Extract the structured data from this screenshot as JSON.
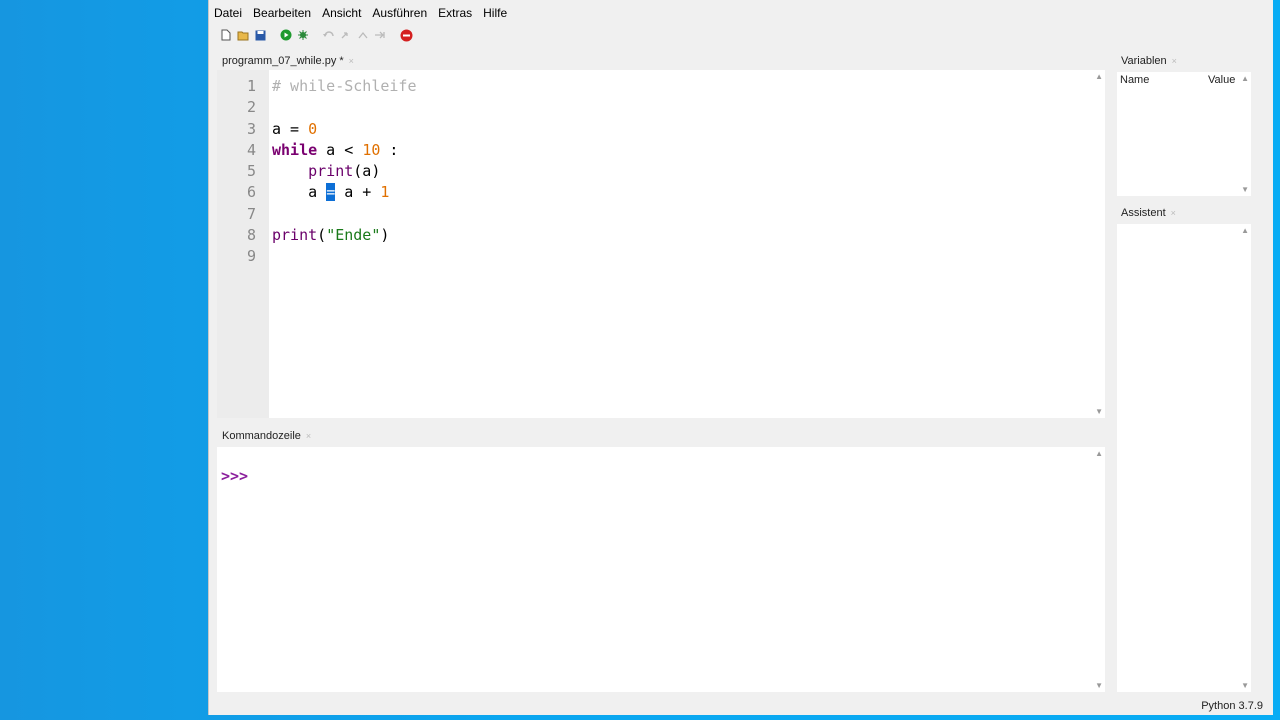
{
  "menu": [
    "Datei",
    "Bearbeiten",
    "Ansicht",
    "Ausführen",
    "Extras",
    "Hilfe"
  ],
  "editor": {
    "tab_label": "programm_07_while.py *",
    "lines": [
      {
        "n": "1",
        "tokens": [
          {
            "t": "# while-Schleife",
            "c": "cm"
          }
        ]
      },
      {
        "n": "2",
        "tokens": []
      },
      {
        "n": "3",
        "tokens": [
          {
            "t": "a = ",
            "c": "src"
          },
          {
            "t": "0",
            "c": "num"
          }
        ]
      },
      {
        "n": "4",
        "tokens": [
          {
            "t": "while",
            "c": "kw"
          },
          {
            "t": " a < ",
            "c": "src"
          },
          {
            "t": "10",
            "c": "num"
          },
          {
            "t": " :",
            "c": "src"
          }
        ]
      },
      {
        "n": "5",
        "tokens": [
          {
            "t": "    ",
            "c": "src"
          },
          {
            "t": "print",
            "c": "fn"
          },
          {
            "t": "(a)",
            "c": "src"
          }
        ]
      },
      {
        "n": "6",
        "tokens": [
          {
            "t": "    a ",
            "c": "src"
          },
          {
            "t": "=",
            "c": "sel"
          },
          {
            "t": " a + ",
            "c": "src"
          },
          {
            "t": "1",
            "c": "num"
          }
        ]
      },
      {
        "n": "7",
        "tokens": []
      },
      {
        "n": "8",
        "tokens": [
          {
            "t": "print",
            "c": "fn"
          },
          {
            "t": "(",
            "c": "src"
          },
          {
            "t": "\"Ende\"",
            "c": "str"
          },
          {
            "t": ")",
            "c": "src"
          }
        ]
      },
      {
        "n": "9",
        "tokens": []
      }
    ]
  },
  "console": {
    "tab_label": "Kommandozeile",
    "prompt": ">>>"
  },
  "variables": {
    "tab_label": "Variablen",
    "col_name": "Name",
    "col_value": "Value"
  },
  "assistant": {
    "tab_label": "Assistent"
  },
  "status": {
    "python_version": "Python 3.7.9"
  },
  "tab_close_glyph": "×",
  "icons": [
    "new-file-icon",
    "open-folder-icon",
    "save-icon",
    "run-icon",
    "debug-icon",
    "undo-icon",
    "redo-icon",
    "step-icon",
    "step-over-icon",
    "stop-icon"
  ]
}
